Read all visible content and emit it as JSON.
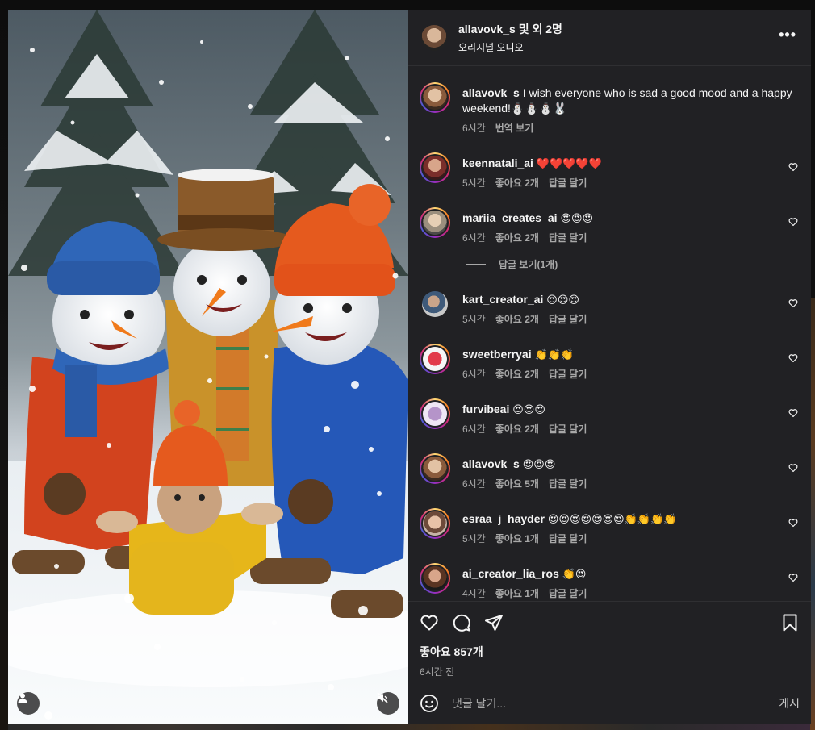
{
  "post": {
    "owner": "allavovk_s",
    "collab_text": " 및 외 2명",
    "audio_label": "오리지널 오디오",
    "caption": {
      "username": "allavovk_s",
      "text": "I wish everyone who is sad a good mood and a happy weekend!⛄⛄⛄🐰",
      "time": "6시간",
      "translate": "번역 보기"
    },
    "likes": "좋아요 857개",
    "posted": "6시간 전"
  },
  "comments": [
    {
      "username": "keennatali_ai",
      "text": "❤️❤️❤️❤️❤️",
      "time": "5시간",
      "likes": "좋아요 2개",
      "reply": "답글 달기"
    },
    {
      "username": "mariia_creates_ai",
      "text": "😍😍😍",
      "time": "6시간",
      "likes": "좋아요 2개",
      "reply": "답글 달기"
    },
    {
      "username": "kart_creator_ai",
      "text": "😍😍😍",
      "time": "5시간",
      "likes": "좋아요 2개",
      "reply": "답글 달기"
    },
    {
      "username": "sweetberryai",
      "text": "👏👏👏",
      "time": "6시간",
      "likes": "좋아요 2개",
      "reply": "답글 달기"
    },
    {
      "username": "furvibeai",
      "text": "😍😍😍",
      "time": "6시간",
      "likes": "좋아요 2개",
      "reply": "답글 달기"
    },
    {
      "username": "allavovk_s",
      "text": "😍😍😍",
      "time": "6시간",
      "likes": "좋아요 5개",
      "reply": "답글 달기"
    },
    {
      "username": "esraa_j_hayder",
      "text": "😍😍😍😍😍😍😍👏👏👏👏",
      "time": "5시간",
      "likes": "좋아요 1개",
      "reply": "답글 달기"
    },
    {
      "username": "ai_creator_lia_ros",
      "text": "👏😍",
      "time": "4시간",
      "likes": "좋아요 1개",
      "reply": "답글 달기"
    }
  ],
  "view_replies": "답글 보기(1개)",
  "add_comment": {
    "placeholder": "댓글 달기...",
    "post_label": "게시"
  },
  "icons": {
    "more": "more-icon",
    "like": "heart-icon",
    "comment": "comment-icon",
    "share": "share-icon",
    "save": "bookmark-icon",
    "emoji": "emoji-icon",
    "user_tag": "user-icon",
    "mute": "muted-speaker-icon"
  },
  "colors": {
    "panel_bg": "#212124",
    "text": "#f5f5f5",
    "muted_text": "#a8a8a8"
  }
}
